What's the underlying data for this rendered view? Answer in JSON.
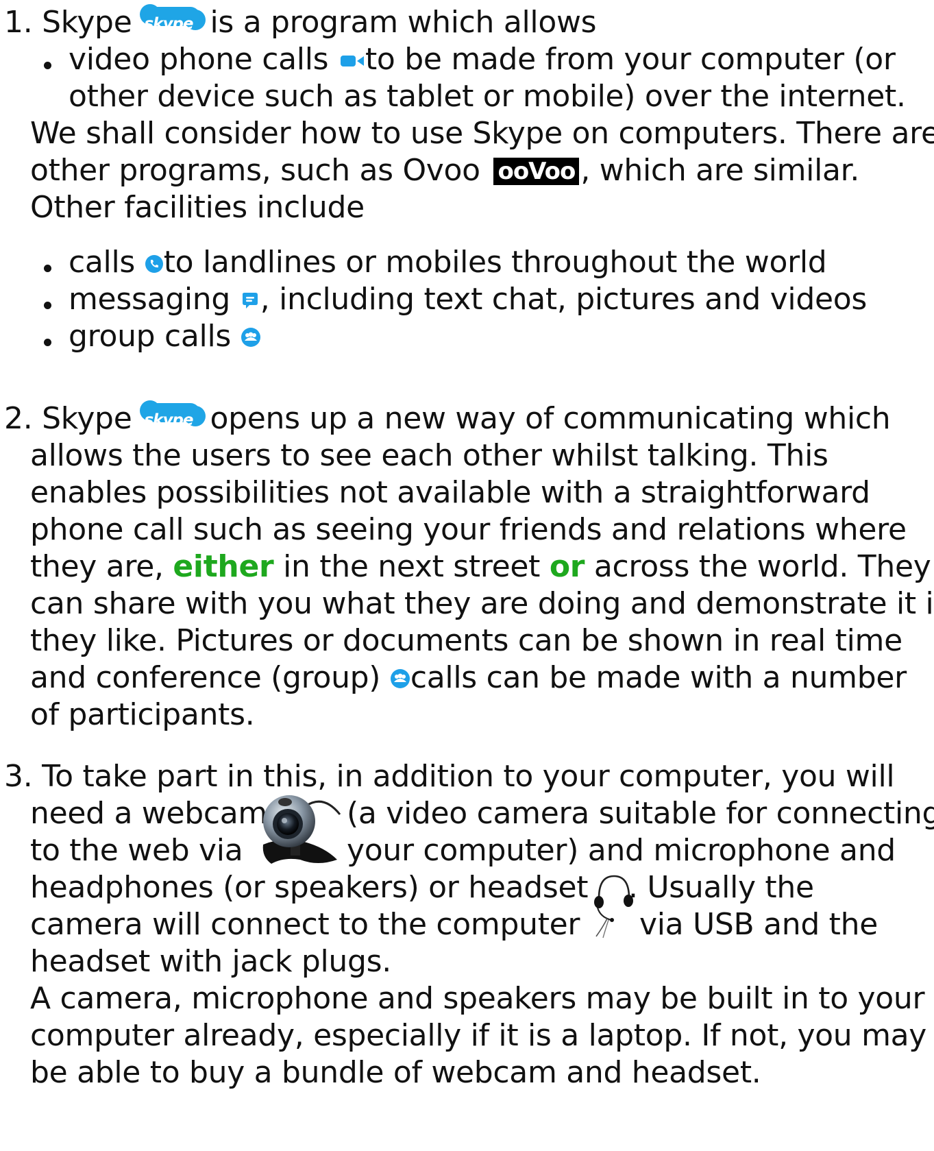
{
  "section1": {
    "num": "1.",
    "intro_a": "Skype",
    "intro_b": "is a program which allows",
    "skype_logo_text": "skype",
    "bullet_video_a": "video phone calls",
    "bullet_video_b": "to be made from your computer (or",
    "bullet_video_c": "other device such as tablet or mobile) over the internet.",
    "para_a": "We shall consider how to use Skype on computers. There are",
    "para_b1": "other programs, such as Ovoo",
    "ovoo_logo_text": "ooVoo",
    "para_b2": ", which are similar.",
    "para_c": "Other facilities include",
    "bullet_calls_a": "calls",
    "bullet_calls_b": "to landlines or mobiles throughout the world",
    "bullet_msg_a": "messaging",
    "bullet_msg_b": ", including text chat, pictures and videos",
    "bullet_group": "group calls"
  },
  "section2": {
    "num": "2.",
    "l1a": "Skype",
    "l1b": "opens up a new way of communicating which",
    "l2": "allows the users to see each other whilst talking. This",
    "l3": "enables possibilities not available with a straightforward",
    "l4": "phone call such as seeing your friends and relations where",
    "l5a": "they are,",
    "l5_either": "either",
    "l5b": "in the next street",
    "l5_or": "or",
    "l5c": "across the world. They",
    "l6": "can share with you what they are doing and demonstrate it if",
    "l7": "they like. Pictures or documents can be shown in real time",
    "l8a": "and conference (group)",
    "l8b": "calls can be made with a number",
    "l9": "of participants."
  },
  "section3": {
    "num": "3.",
    "l1": "To take part in this, in addition to your computer, you will",
    "l2a": "need a webcam",
    "l2b": "(a video camera suitable for connecting",
    "l3a": "to the web via",
    "l3b": "your computer) and microphone and",
    "l4a": "headphones (or speakers) or headset",
    "l4b": ". Usually the",
    "l5a": "camera will connect to the computer",
    "l5b": "via USB and the",
    "l6": "headset with jack plugs.",
    "l7": "A camera, microphone and speakers may be built in to your",
    "l8": "computer already, especially if it is a laptop. If not, you may",
    "l9": "be able to buy a bundle of webcam and headset."
  },
  "colors": {
    "skype_blue": "#1ea0e8",
    "highlight_green": "#1ea81e",
    "text": "#111111"
  }
}
